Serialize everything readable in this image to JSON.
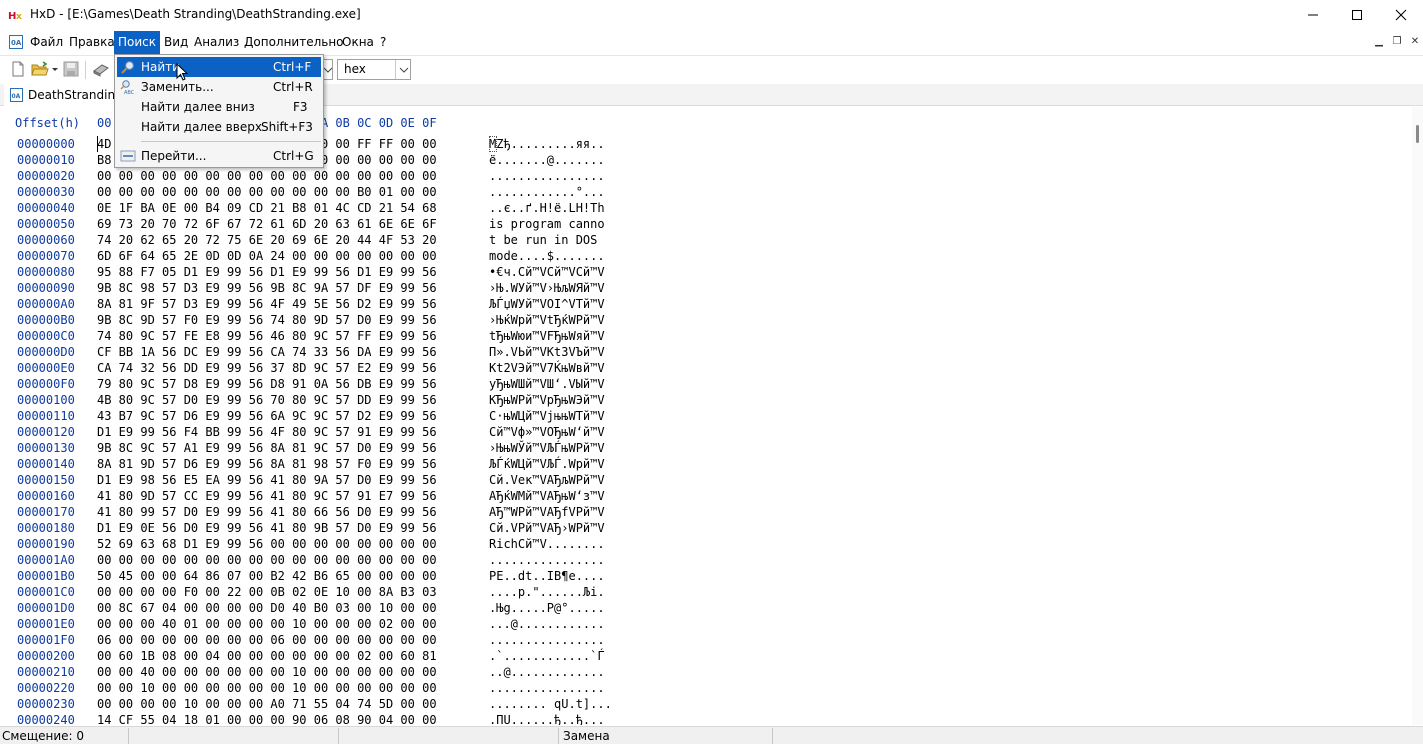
{
  "window": {
    "title": "HxD - [E:\\Games\\Death Stranding\\DeathStranding.exe]"
  },
  "menu": [
    {
      "label": "Файл",
      "left": 0
    },
    {
      "label": "Правка"
    },
    {
      "label": "Поиск"
    },
    {
      "label": "Вид"
    },
    {
      "label": "Анализ"
    },
    {
      "label": "Дополнительно"
    },
    {
      "label": "Окна"
    },
    {
      "label": "?"
    }
  ],
  "toolbar": {
    "encoding_value": "hex"
  },
  "tab": {
    "file_label": "DeathStranding."
  },
  "search_menu": {
    "items": [
      {
        "label": "Найти",
        "shortcut": "Ctrl+F"
      },
      {
        "label": "Заменить...",
        "shortcut": "Ctrl+R"
      },
      {
        "label": "Найти далее вниз",
        "shortcut": "F3"
      },
      {
        "label": "Найти далее вверх",
        "shortcut": "Shift+F3"
      },
      {
        "label": "Перейти...",
        "shortcut": "Ctrl+G"
      }
    ]
  },
  "hex": {
    "header_offset": "Offset(h)",
    "header_columns": "00 01 02 03 04 05 06 07 08 09 0A 0B 0C 0D 0E 0F",
    "rows": [
      {
        "o": "00000000",
        "h": "4D 5A 90 00 03 00 00 00 04 00 00 00 FF FF 00 00",
        "a": "MZђ.........яя.."
      },
      {
        "o": "00000010",
        "h": "B8 00 00 00 00 00 00 00 40 00 00 00 00 00 00 00",
        "a": "ё.......@......."
      },
      {
        "o": "00000020",
        "h": "00 00 00 00 00 00 00 00 00 00 00 00 00 00 00 00",
        "a": "................"
      },
      {
        "o": "00000030",
        "h": "00 00 00 00 00 00 00 00 00 00 00 00 B0 01 00 00",
        "a": "............°..."
      },
      {
        "o": "00000040",
        "h": "0E 1F BA 0E 00 B4 09 CD 21 B8 01 4C CD 21 54 68",
        "a": "..є..ґ.Н!ё.LН!Th"
      },
      {
        "o": "00000050",
        "h": "69 73 20 70 72 6F 67 72 61 6D 20 63 61 6E 6E 6F",
        "a": "is program canno"
      },
      {
        "o": "00000060",
        "h": "74 20 62 65 20 72 75 6E 20 69 6E 20 44 4F 53 20",
        "a": "t be run in DOS "
      },
      {
        "o": "00000070",
        "h": "6D 6F 64 65 2E 0D 0D 0A 24 00 00 00 00 00 00 00",
        "a": "mode....$......."
      },
      {
        "o": "00000080",
        "h": "95 88 F7 05 D1 E9 99 56 D1 E9 99 56 D1 E9 99 56",
        "a": "•€ч.Сй™VСй™VСй™V"
      },
      {
        "o": "00000090",
        "h": "9B 8C 98 57 D3 E9 99 56 9B 8C 9A 57 DF E9 99 56",
        "a": "›Њ.WУй™V›ЊљWЯй™V"
      },
      {
        "o": "000000A0",
        "h": "8A 81 9F 57 D3 E9 99 56 4F 49 5E 56 D2 E9 99 56",
        "a": "ЉЃџWУй™VOI^VТй™V"
      },
      {
        "o": "000000B0",
        "h": "9B 8C 9D 57 F0 E9 99 56 74 80 9D 57 D0 E9 99 56",
        "a": "›ЊќWрй™VtЂќWРй™V"
      },
      {
        "o": "000000C0",
        "h": "74 80 9C 57 FE E8 99 56 46 80 9C 57 FF E9 99 56",
        "a": "tЂњWюи™VFЂњWяй™V"
      },
      {
        "o": "000000D0",
        "h": "CF BB 1A 56 DC E9 99 56 CA 74 33 56 DA E9 99 56",
        "a": "П».VЬй™VКt3VЪй™V"
      },
      {
        "o": "000000E0",
        "h": "CA 74 32 56 DD E9 99 56 37 8D 9C 57 E2 E9 99 56",
        "a": "Кt2VЭй™V7ЌњWвй™V"
      },
      {
        "o": "000000F0",
        "h": "79 80 9C 57 D8 E9 99 56 D8 91 0A 56 DB E9 99 56",
        "a": "yЂњWШй™VШ‘.VЫй™V"
      },
      {
        "o": "00000100",
        "h": "4B 80 9C 57 D0 E9 99 56 70 80 9C 57 DD E9 99 56",
        "a": "KЂњWРй™VpЂњWЭй™V"
      },
      {
        "o": "00000110",
        "h": "43 B7 9C 57 D6 E9 99 56 6A 9C 9C 57 D2 E9 99 56",
        "a": "C·њWЦй™VjњњWТй™V"
      },
      {
        "o": "00000120",
        "h": "D1 E9 99 56 F4 BB 99 56 4F 80 9C 57 91 E9 99 56",
        "a": "Сй™Vф»™VOЂњW‘й™V"
      },
      {
        "o": "00000130",
        "h": "9B 8C 9C 57 A1 E9 99 56 8A 81 9C 57 D0 E9 99 56",
        "a": "›ЊњWЎй™VЉЃњWРй™V"
      },
      {
        "o": "00000140",
        "h": "8A 81 9D 57 D6 E9 99 56 8A 81 98 57 F0 E9 99 56",
        "a": "ЉЃќWЦй™VЉЃ.Wрй™V"
      },
      {
        "o": "00000150",
        "h": "D1 E9 98 56 E5 EA 99 56 41 80 9A 57 D0 E9 99 56",
        "a": "Сй.Vек™VAЂљWРй™V"
      },
      {
        "o": "00000160",
        "h": "41 80 9D 57 CC E9 99 56 41 80 9C 57 91 E7 99 56",
        "a": "AЂќWМй™VAЂњW‘з™V"
      },
      {
        "o": "00000170",
        "h": "41 80 99 57 D0 E9 99 56 41 80 66 56 D0 E9 99 56",
        "a": "AЂ™WРй™VAЂfVРй™V"
      },
      {
        "o": "00000180",
        "h": "D1 E9 0E 56 D0 E9 99 56 41 80 9B 57 D0 E9 99 56",
        "a": "Сй.VРй™VAЂ›WРй™V"
      },
      {
        "o": "00000190",
        "h": "52 69 63 68 D1 E9 99 56 00 00 00 00 00 00 00 00",
        "a": "RichСй™V........"
      },
      {
        "o": "000001A0",
        "h": "00 00 00 00 00 00 00 00 00 00 00 00 00 00 00 00",
        "a": "................"
      },
      {
        "o": "000001B0",
        "h": "50 45 00 00 64 86 07 00 B2 42 B6 65 00 00 00 00",
        "a": "PE..dt..IB¶e...."
      },
      {
        "o": "000001C0",
        "h": "00 00 00 00 F0 00 22 00 0B 02 0E 10 00 8A B3 03",
        "a": "....р.\"......Љі."
      },
      {
        "o": "000001D0",
        "h": "00 8C 67 04 00 00 00 00 D0 40 B0 03 00 10 00 00",
        "a": ".Њg.....Р@°....."
      },
      {
        "o": "000001E0",
        "h": "00 00 00 40 01 00 00 00 00 10 00 00 00 02 00 00",
        "a": "...@............"
      },
      {
        "o": "000001F0",
        "h": "06 00 00 00 00 00 00 00 06 00 00 00 00 00 00 00",
        "a": "................"
      },
      {
        "o": "00000200",
        "h": "00 60 1B 08 00 04 00 00 00 00 00 00 02 00 60 81",
        "a": ".`............`Ѓ"
      },
      {
        "o": "00000210",
        "h": "00 00 40 00 00 00 00 00 00 10 00 00 00 00 00 00",
        "a": "..@............."
      },
      {
        "o": "00000220",
        "h": "00 00 10 00 00 00 00 00 00 10 00 00 00 00 00 00",
        "a": "................"
      },
      {
        "o": "00000230",
        "h": "00 00 00 00 10 00 00 00 A0 71 55 04 74 5D 00 00",
        "a": "........ qU.t]..."
      },
      {
        "o": "00000240",
        "h": "14 CF 55 04 18 01 00 00 00 90 06 08 90 04 00 00",
        "a": ".ПU......ђ..ђ..."
      }
    ]
  },
  "status": {
    "offset": "Смещение: 0",
    "mode": "Замена"
  }
}
